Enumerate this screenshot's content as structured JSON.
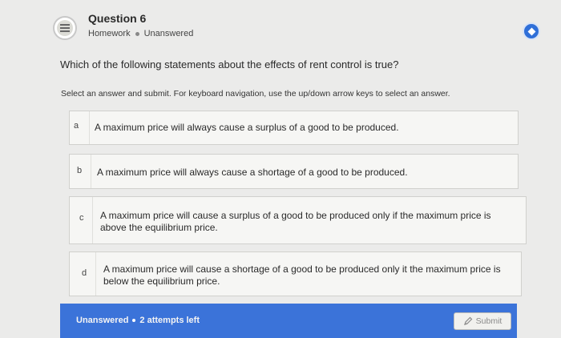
{
  "header": {
    "icon": "quiz-list-icon",
    "title": "Question 6",
    "type": "Homework",
    "status": "Unanswered"
  },
  "corner_button": {
    "icon": "diamond-icon",
    "color": "#2f6fd8"
  },
  "question": "Which of the following statements about the effects of rent control is true?",
  "instructions": "Select an answer and submit. For keyboard navigation, use the up/down arrow keys to select an answer.",
  "options": [
    {
      "letter": "a",
      "text": "A maximum price will always cause a surplus of a good to be produced."
    },
    {
      "letter": "b",
      "text": "A maximum price will always cause a shortage of a good to be produced."
    },
    {
      "letter": "c",
      "text": "A maximum price will cause a surplus of a good to be produced only if the maximum price is above the equilibrium price."
    },
    {
      "letter": "d",
      "text": "A maximum price will cause a shortage of a good to be produced only it the maximum price is below the equilibrium price."
    }
  ],
  "footer": {
    "status": "Unanswered",
    "attempts": "2 attempts left",
    "submit_label": "Submit",
    "submit_icon": "pencil-icon",
    "bar_color": "#3b73d9"
  }
}
